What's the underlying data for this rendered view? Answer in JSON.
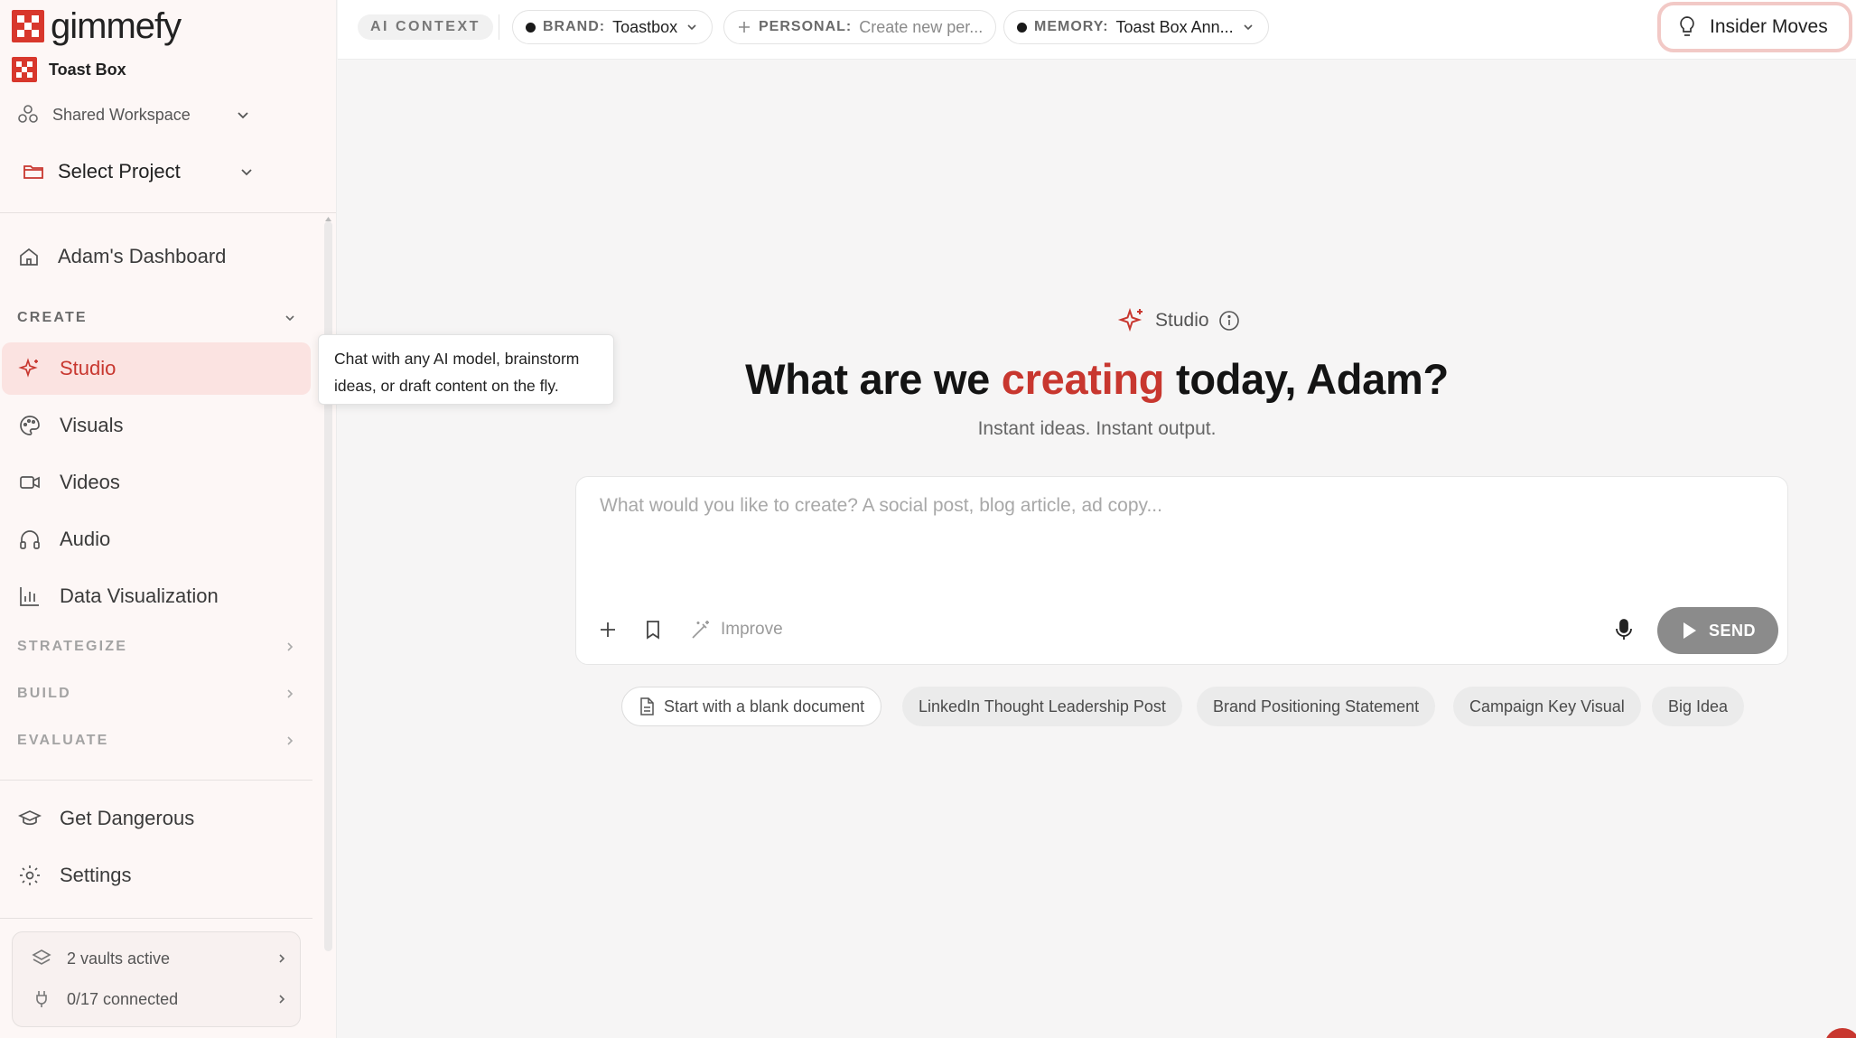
{
  "app": {
    "logo_text": "gimmefy",
    "org_name": "Toast Box"
  },
  "sidebar": {
    "workspace_label": "Shared Workspace",
    "project_label": "Select Project",
    "dashboard_label": "Adam's Dashboard",
    "create_section": "CREATE",
    "create_items": [
      {
        "label": "Studio",
        "icon": "sparkle-icon",
        "active": true
      },
      {
        "label": "Visuals",
        "icon": "palette-icon"
      },
      {
        "label": "Videos",
        "icon": "video-camera-icon"
      },
      {
        "label": "Audio",
        "icon": "headphones-icon"
      },
      {
        "label": "Data Visualization",
        "icon": "bar-chart-icon"
      }
    ],
    "sections": [
      "STRATEGIZE",
      "BUILD",
      "EVALUATE"
    ],
    "bottom_items": [
      {
        "label": "Get Dangerous",
        "icon": "graduation-cap-icon"
      },
      {
        "label": "Settings",
        "icon": "gear-icon"
      }
    ],
    "vaults_label": "2 vaults active",
    "connected_label": "0/17 connected"
  },
  "topbar": {
    "context_tag": "AI CONTEXT",
    "brand_key": "BRAND:",
    "brand_value": "Toastbox",
    "personal_key": "PERSONAL:",
    "personal_value": "Create new per...",
    "memory_key": "MEMORY:",
    "memory_value": "Toast Box Ann...",
    "insider_label": "Insider Moves"
  },
  "main": {
    "studio_label": "Studio",
    "headline_pre": "What are we",
    "headline_accent": "creating",
    "headline_post": "today, Adam?",
    "subline": "Instant ideas. Instant output.",
    "composer_placeholder": "What would you like to create? A social post, blog article, ad copy...",
    "improve_label": "Improve",
    "send_label": "SEND",
    "suggestions": [
      "Start with a blank document",
      "LinkedIn Thought Leadership Post",
      "Brand Positioning Statement",
      "Campaign Key Visual",
      "Big Idea"
    ]
  },
  "tooltip": {
    "text": "Chat with any AI model, brainstorm ideas, or draft content on the fly."
  },
  "colors": {
    "accent": "#c8372f",
    "active_bg": "#fbe3e1",
    "sidebar_bg": "#fdf7f6",
    "send_bg": "#8b8b8b"
  }
}
